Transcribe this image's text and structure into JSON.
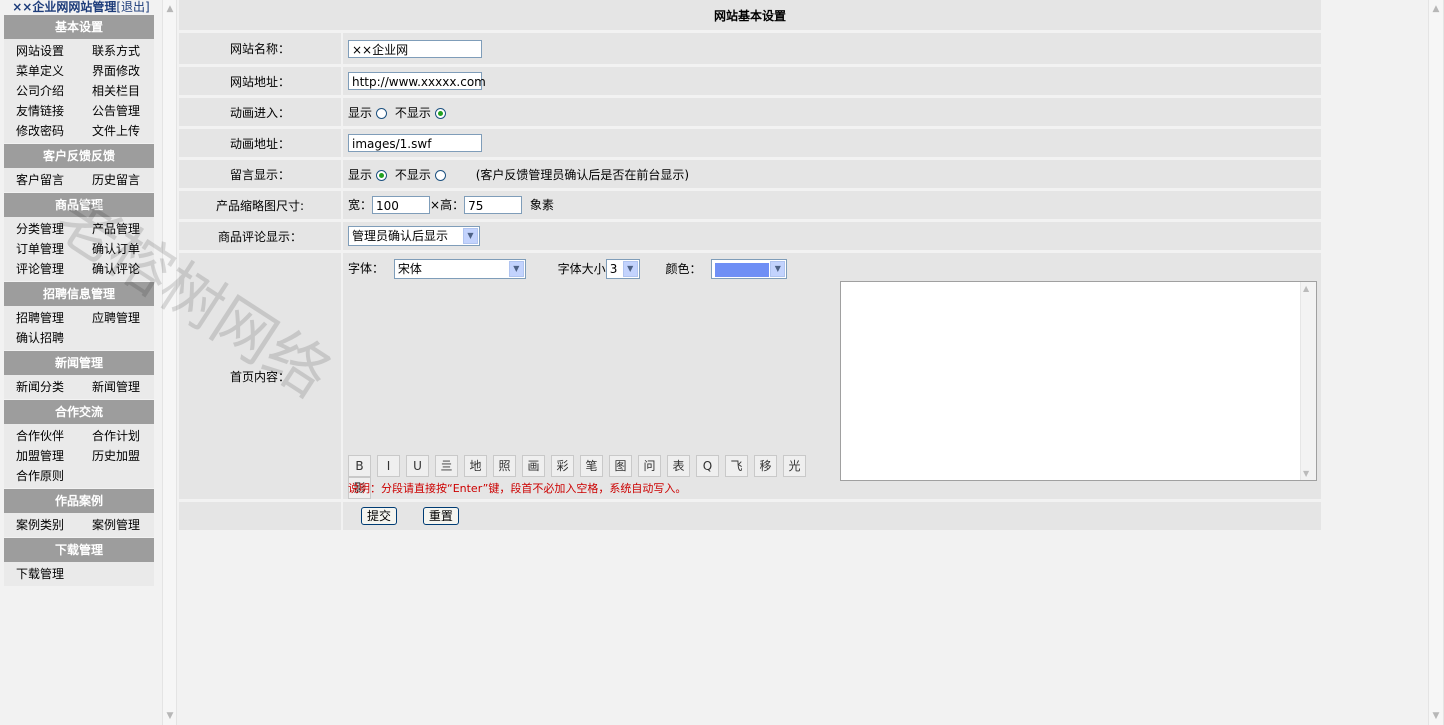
{
  "sidebar": {
    "title": "××企业网网站管理",
    "logout": "[退出]",
    "groups": [
      {
        "title": "基本设置",
        "items": [
          "网站设置",
          "联系方式",
          "菜单定义",
          "界面修改",
          "公司介绍",
          "相关栏目",
          "友情链接",
          "公告管理",
          "修改密码",
          "文件上传"
        ]
      },
      {
        "title": "客户反馈反馈",
        "items": [
          "客户留言",
          "历史留言"
        ]
      },
      {
        "title": "商品管理",
        "items": [
          "分类管理",
          "产品管理",
          "订单管理",
          "确认订单",
          "评论管理",
          "确认评论"
        ]
      },
      {
        "title": "招聘信息管理",
        "items": [
          "招聘管理",
          "应聘管理",
          "确认招聘"
        ]
      },
      {
        "title": "新闻管理",
        "items": [
          "新闻分类",
          "新闻管理"
        ]
      },
      {
        "title": "合作交流",
        "items": [
          "合作伙伴",
          "合作计划",
          "加盟管理",
          "历史加盟",
          "合作原则"
        ]
      },
      {
        "title": "作品案例",
        "items": [
          "案例类别",
          "案例管理"
        ]
      },
      {
        "title": "下载管理",
        "items": [
          "下载管理"
        ]
      }
    ]
  },
  "form": {
    "heading": "网站基本设置",
    "site_name": {
      "label": "网站名称：",
      "value": "××企业网"
    },
    "site_url": {
      "label": "网站地址：",
      "value": "http://www.xxxxx.com"
    },
    "anim_enter": {
      "label": "动画进入：",
      "show": "显示",
      "hide": "不显示"
    },
    "anim_url": {
      "label": "动画地址：",
      "value": "images/1.swf"
    },
    "guestbook": {
      "label": "留言显示：",
      "show": "显示",
      "hide": "不显示",
      "note": "(客户反馈管理员确认后是否在前台显示)"
    },
    "thumb": {
      "label": "产品缩略图尺寸:",
      "width_label": "宽：",
      "width": "100",
      "height_label": "×高：",
      "height": "75",
      "unit": "象素"
    },
    "review": {
      "label": "商品评论显示：",
      "value": "管理员确认后显示"
    },
    "content": {
      "label": "首页内容：",
      "font_label": "字体：",
      "font_value": "宋体",
      "size_label": "字体大小",
      "size_value": "3",
      "color_label": "颜色：",
      "color_value": "#6f8ff5",
      "toolbar": [
        "B",
        "I",
        "U",
        "亖",
        "地",
        "照",
        "画",
        "彩",
        "笔",
        "图",
        "问",
        "表",
        "Q",
        "飞",
        "移",
        "光",
        "影"
      ],
      "note": "说明：分段请直接按“Enter”键，段首不必加入空格，系统自动写入。"
    },
    "submit": "提交",
    "reset": "重置"
  },
  "watermark": "老榕树网络"
}
